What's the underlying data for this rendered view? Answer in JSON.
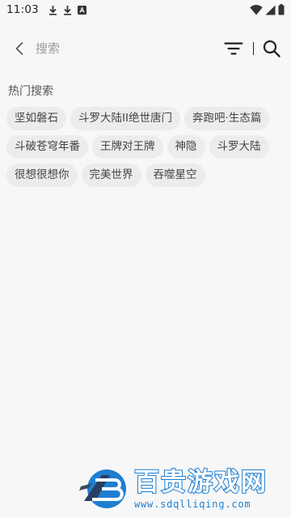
{
  "status_bar": {
    "time": "11:03",
    "icons_left": [
      "download-icon",
      "download-icon",
      "app-notification-icon"
    ],
    "icons_right": [
      "wifi-icon",
      "signal-icon",
      "battery-icon"
    ]
  },
  "header": {
    "search_placeholder": "搜索",
    "icons": [
      "back-arrow-icon",
      "filter-icon",
      "search-icon"
    ]
  },
  "hot_search": {
    "title": "热门搜索",
    "tags": [
      "坚如磐石",
      "斗罗大陆II绝世唐门",
      "奔跑吧·生态篇",
      "斗破苍穹年番",
      "王牌对王牌",
      "神隐",
      "斗罗大陆",
      "很想很想你",
      "完美世界",
      "吞噬星空"
    ]
  },
  "watermark": {
    "title": "百贵游戏网",
    "url": "www.sdqlliqing.com",
    "color": "#1e7fd0"
  },
  "colors": {
    "background": "#f7f7f7",
    "tag_background": "#ececec",
    "accent": "#1e7fd0"
  }
}
